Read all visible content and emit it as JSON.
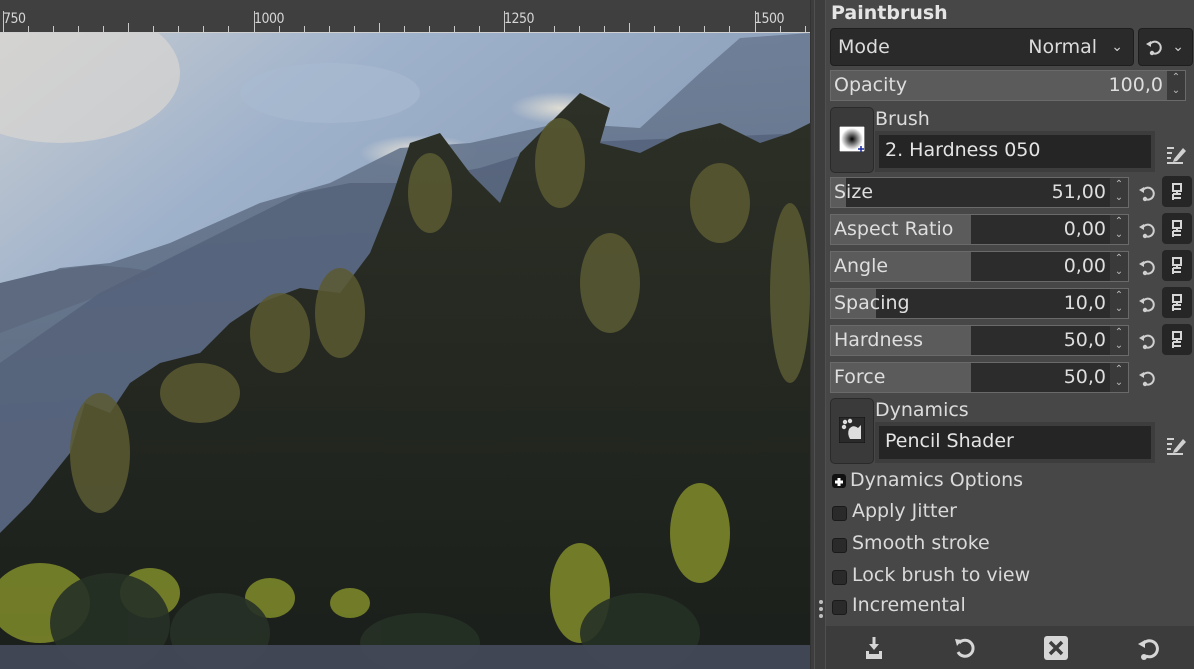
{
  "ruler": {
    "labels": [
      "750",
      "1000",
      "1250",
      "1500"
    ]
  },
  "canvas": {
    "description": "painted mountain landscape with forest (oilify-like brush strokes)",
    "palette": {
      "sky_light": "#c9d0d8",
      "sky_blue": "#8fa3bf",
      "mountain_far": "#6f7f98",
      "mountain_mid": "#56657a",
      "forest_dark": "#1e231f",
      "foliage_olive": "#5b5a32",
      "foliage_bright": "#8d9a2c",
      "ground_stones": "#4a4e5e"
    }
  },
  "panel": {
    "title": "Paintbrush",
    "mode": {
      "label": "Mode",
      "value": "Normal"
    },
    "opacity": {
      "label": "Opacity",
      "value": "100,0",
      "fraction": 1.0
    },
    "brush": {
      "label": "Brush",
      "name": "2. Hardness 050"
    },
    "sliders": [
      {
        "label": "Size",
        "value": "51,00",
        "fraction": 0.05,
        "has_chain": true
      },
      {
        "label": "Aspect Ratio",
        "value": "0,00",
        "fraction": 0.47,
        "has_chain": true
      },
      {
        "label": "Angle",
        "value": "0,00",
        "fraction": 0.47,
        "has_chain": true
      },
      {
        "label": "Spacing",
        "value": "10,0",
        "fraction": 0.15,
        "has_chain": true
      },
      {
        "label": "Hardness",
        "value": "50,0",
        "fraction": 0.47,
        "has_chain": true
      },
      {
        "label": "Force",
        "value": "50,0",
        "fraction": 0.47,
        "has_chain": false
      }
    ],
    "dynamics": {
      "label": "Dynamics",
      "name": "Pencil Shader"
    },
    "dynamics_options": {
      "label": "Dynamics Options",
      "expanded": false
    },
    "checkboxes": [
      {
        "label": "Apply Jitter",
        "checked": false
      },
      {
        "label": "Smooth stroke",
        "checked": false
      },
      {
        "label": "Lock brush to view",
        "checked": false
      },
      {
        "label": "Incremental",
        "checked": false
      }
    ],
    "bottom_buttons": [
      {
        "icon": "save-to-preset-icon"
      },
      {
        "icon": "restore-icon"
      },
      {
        "icon": "delete-icon"
      },
      {
        "icon": "reset-icon"
      }
    ]
  }
}
